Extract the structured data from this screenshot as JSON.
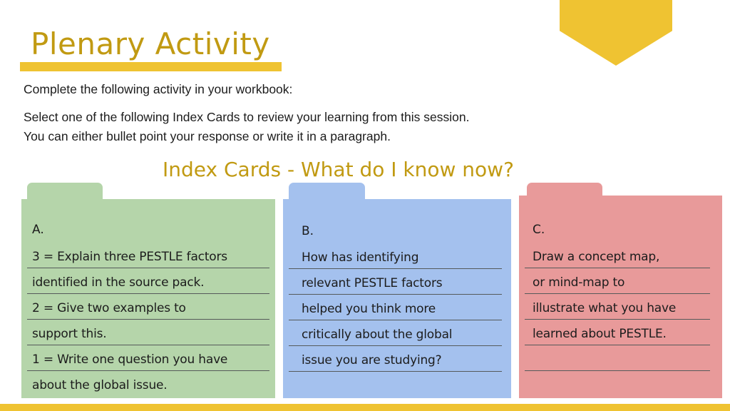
{
  "slide": {
    "title": "Plenary Activity",
    "instructions": [
      "Complete the following activity in your workbook:",
      "Select one of the following Index Cards to review your learning from this session.",
      "You can either bullet point your response or write it in a paragraph."
    ],
    "subtitle": "Index Cards - What do I know now?",
    "colors": {
      "accent_gold": "#c19a12",
      "accent_yellow": "#efc332",
      "card_a": "#b5d5aa",
      "card_b": "#a4c1ee",
      "card_c": "#e89a9a"
    }
  },
  "cards": [
    {
      "letter": "A.",
      "lines": [
        "3 = Explain three PESTLE factors",
        "identified in the source pack.",
        "2 = Give two examples to",
        "support this.",
        "1 = Write one question you have",
        "about the global issue."
      ]
    },
    {
      "letter": "B.",
      "lines": [
        "How has identifying",
        "relevant PESTLE factors",
        "helped you think more",
        "critically about the global",
        "issue you are studying?"
      ]
    },
    {
      "letter": "C.",
      "lines": [
        "Draw a concept map,",
        "or mind-map to",
        "illustrate what you have",
        "learned about PESTLE.",
        ""
      ]
    }
  ]
}
